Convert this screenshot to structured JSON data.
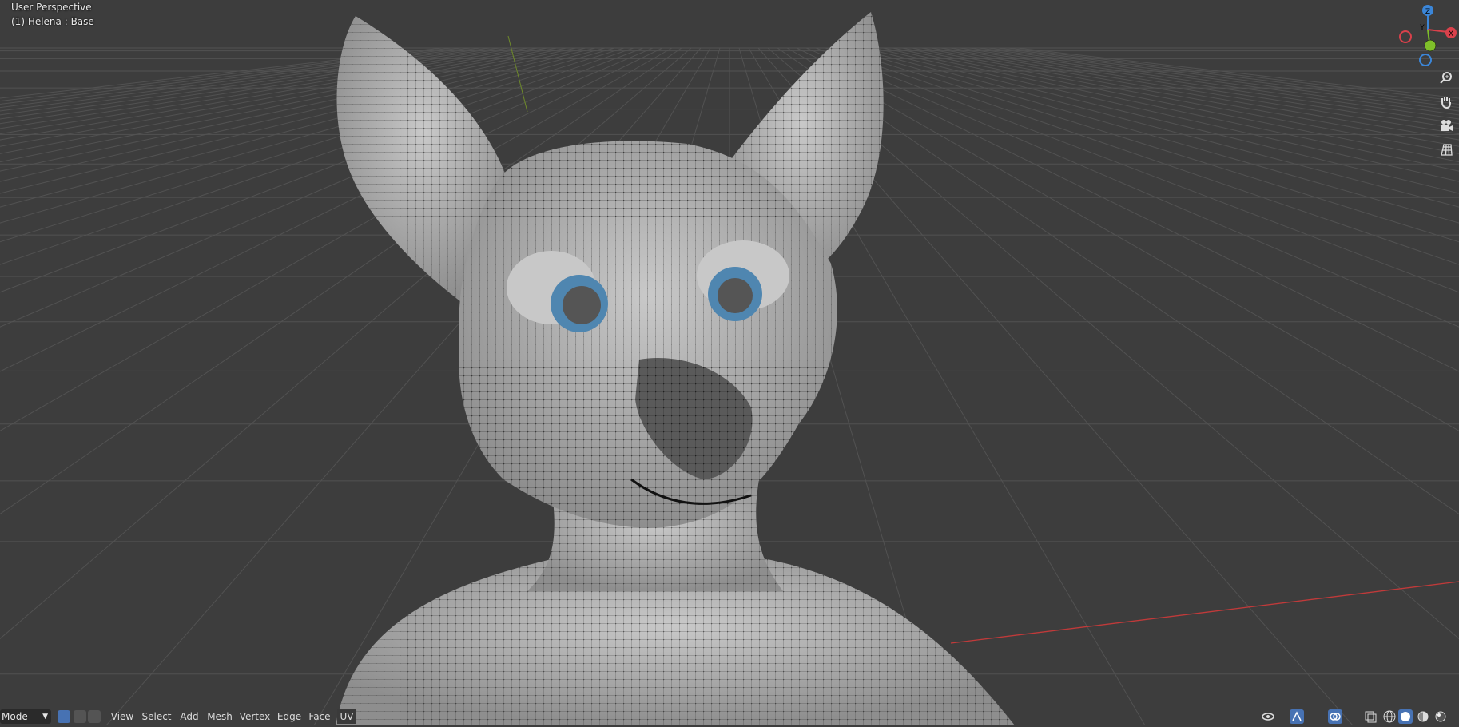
{
  "overlay": {
    "perspective_label": "User Perspective",
    "object_label": "(1) Helena : Base"
  },
  "gizmo": {
    "axis_z": "Z",
    "axis_y": "Y",
    "axis_x": "X",
    "color_x": "#d9414b",
    "color_y": "#7fbf2a",
    "color_z": "#3b86d8"
  },
  "nav_buttons": [
    "zoom-icon",
    "hand-pan-icon",
    "camera-icon",
    "grid-icon"
  ],
  "header": {
    "mode_label": "Mode",
    "menu": [
      "View",
      "Select",
      "Add",
      "Mesh",
      "Vertex",
      "Edge",
      "Face",
      "UV"
    ]
  },
  "colors": {
    "background": "#3d3d3d",
    "grid": "#525252",
    "x_axis": "#c03a3a",
    "y_axis": "#6e8a2a",
    "mesh": "#aeaeae",
    "eye_iris": "#4f86b0"
  }
}
